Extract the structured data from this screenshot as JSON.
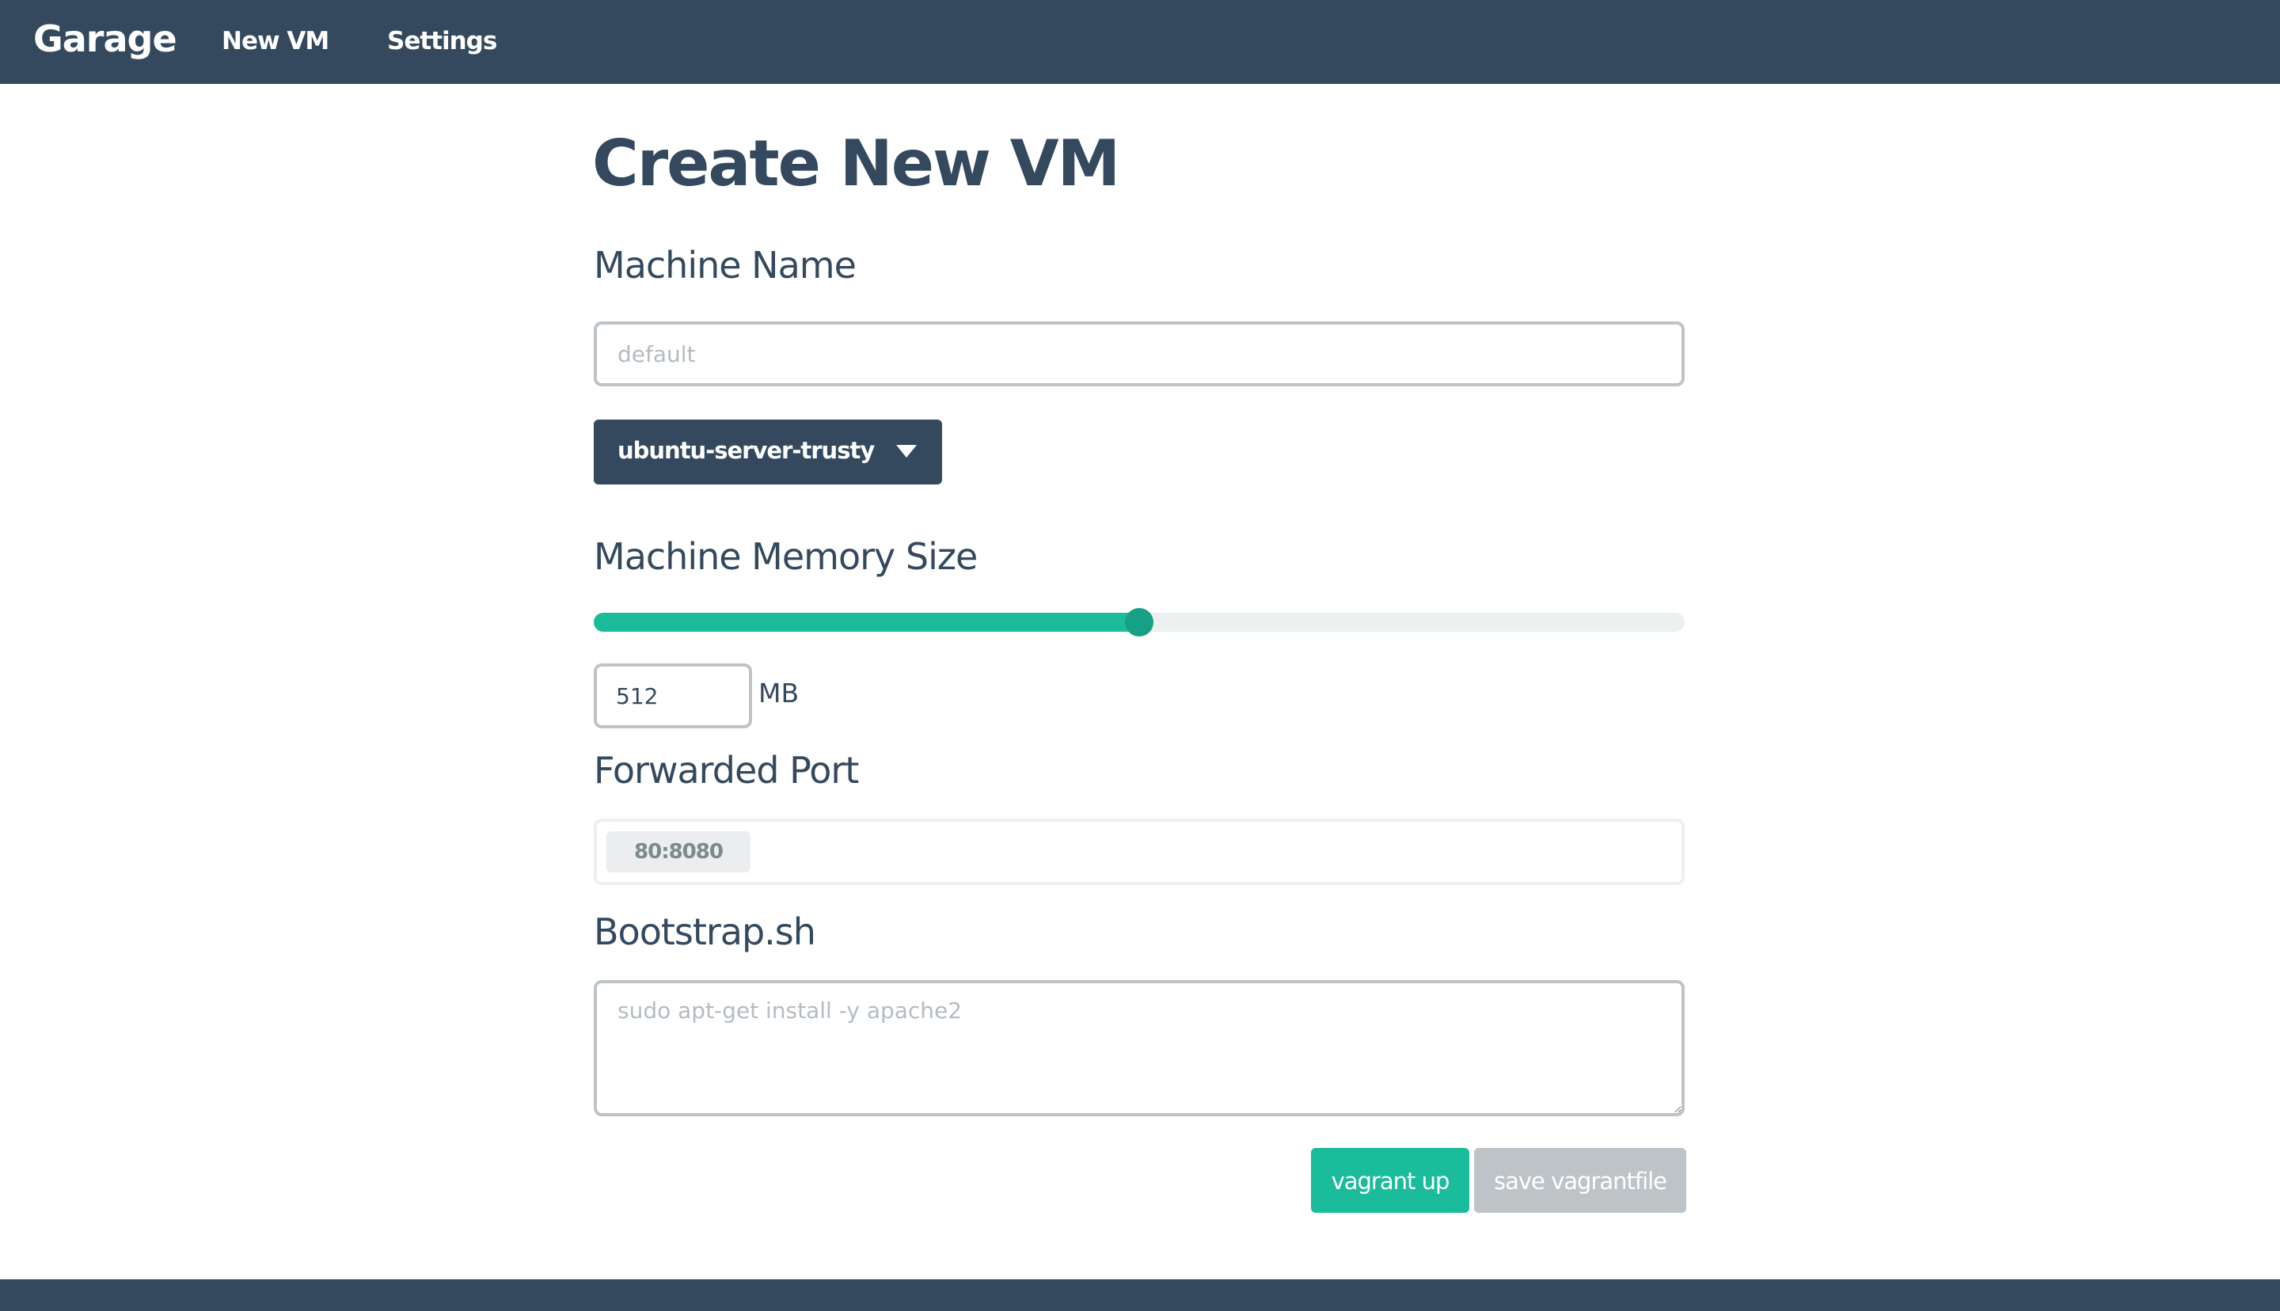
{
  "navbar": {
    "brand": "Garage",
    "links": [
      "New VM",
      "Settings"
    ]
  },
  "page": {
    "title": "Create New VM"
  },
  "machine_name": {
    "label": "Machine Name",
    "placeholder": "default",
    "value": ""
  },
  "box_select": {
    "selected": "ubuntu-server-trusty"
  },
  "memory": {
    "label": "Machine Memory Size",
    "value": "512",
    "unit": "MB",
    "slider_fraction": 0.5
  },
  "forwarded_port": {
    "label": "Forwarded Port",
    "tags": [
      "80:8080"
    ]
  },
  "bootstrap": {
    "label": "Bootstrap.sh",
    "placeholder": "sudo apt-get install -y apache2"
  },
  "actions": {
    "primary": "vagrant up",
    "secondary": "save vagrantfile"
  },
  "colors": {
    "navbar": "#34495e",
    "accent": "#1abc9c",
    "accent_dark": "#16a085",
    "muted": "#bdc3c7"
  }
}
